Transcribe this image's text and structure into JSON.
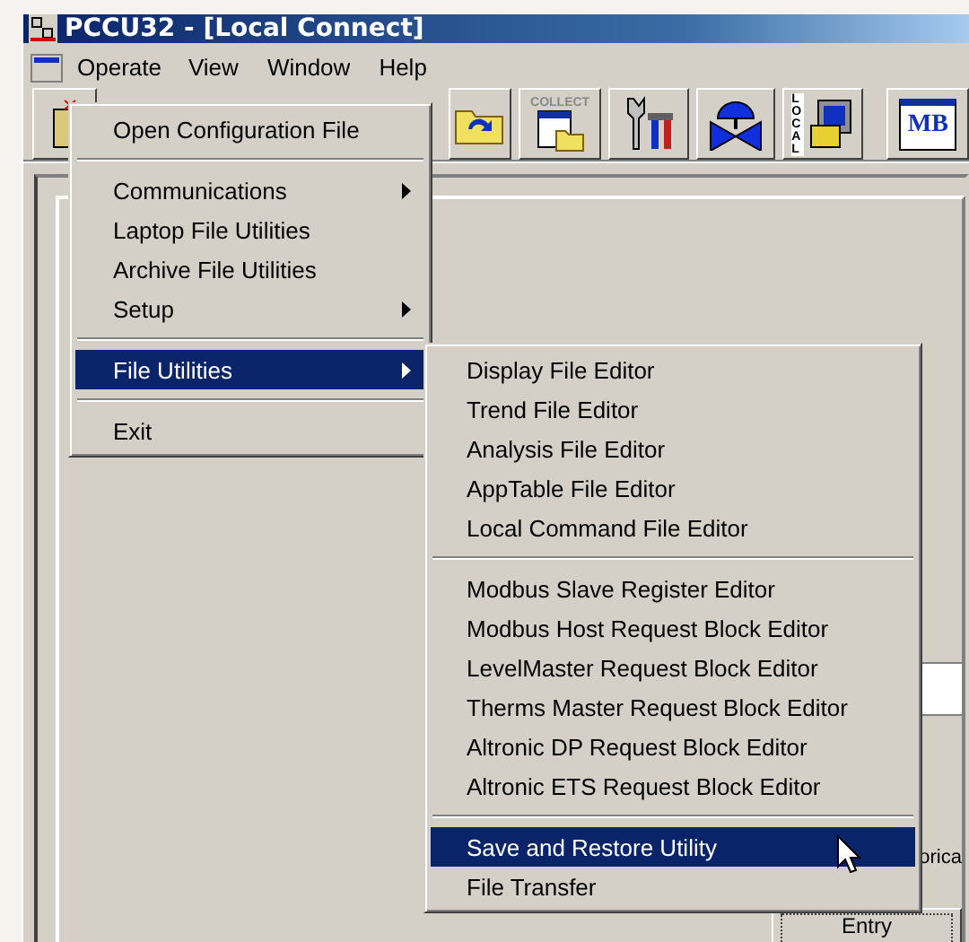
{
  "window": {
    "title": "PCCU32 - [Local Connect]"
  },
  "menu_bar": [
    {
      "label": "Operate",
      "selected": true
    },
    {
      "label": "View",
      "selected": false
    },
    {
      "label": "Window",
      "selected": false
    },
    {
      "label": "Help",
      "selected": false
    }
  ],
  "toolbar": [
    {
      "kind": "connect"
    },
    {
      "kind": "refresh_folder"
    },
    {
      "kind": "collect",
      "label": "COLLECT"
    },
    {
      "kind": "tools"
    },
    {
      "kind": "valve"
    },
    {
      "kind": "local",
      "label": "LOCAL"
    },
    {
      "kind": "modbus",
      "label": "MB"
    }
  ],
  "operate_menu": [
    {
      "kind": "item",
      "label": "Open Configuration File",
      "submenu": false,
      "selected": false
    },
    {
      "kind": "separator"
    },
    {
      "kind": "item",
      "label": "Communications",
      "submenu": true,
      "selected": false
    },
    {
      "kind": "item",
      "label": "Laptop File Utilities",
      "submenu": false,
      "selected": false
    },
    {
      "kind": "item",
      "label": "Archive File Utilities",
      "submenu": false,
      "selected": false
    },
    {
      "kind": "item",
      "label": "Setup",
      "submenu": true,
      "selected": false
    },
    {
      "kind": "separator"
    },
    {
      "kind": "item",
      "label": "File Utilities",
      "submenu": true,
      "selected": true
    },
    {
      "kind": "separator"
    },
    {
      "kind": "item",
      "label": "Exit",
      "submenu": false,
      "selected": false
    }
  ],
  "file_utilities_menu": [
    {
      "kind": "item",
      "label": "Display File Editor",
      "submenu": false,
      "selected": false
    },
    {
      "kind": "item",
      "label": "Trend File Editor",
      "submenu": false,
      "selected": false
    },
    {
      "kind": "item",
      "label": "Analysis File Editor",
      "submenu": false,
      "selected": false
    },
    {
      "kind": "item",
      "label": "AppTable File Editor",
      "submenu": false,
      "selected": false
    },
    {
      "kind": "item",
      "label": "Local Command File Editor",
      "submenu": false,
      "selected": false
    },
    {
      "kind": "separator"
    },
    {
      "kind": "item",
      "label": "Modbus Slave Register Editor",
      "submenu": false,
      "selected": false
    },
    {
      "kind": "item",
      "label": "Modbus Host Request Block Editor",
      "submenu": false,
      "selected": false
    },
    {
      "kind": "item",
      "label": "LevelMaster Request Block Editor",
      "submenu": false,
      "selected": false
    },
    {
      "kind": "item",
      "label": "Therms Master Request Block Editor",
      "submenu": false,
      "selected": false
    },
    {
      "kind": "item",
      "label": "Altronic DP Request Block Editor",
      "submenu": false,
      "selected": false
    },
    {
      "kind": "item",
      "label": "Altronic ETS Request Block Editor",
      "submenu": false,
      "selected": false
    },
    {
      "kind": "separator"
    },
    {
      "kind": "item",
      "label": "Save and Restore Utility",
      "submenu": false,
      "selected": true
    },
    {
      "kind": "item",
      "label": "File Transfer",
      "submenu": false,
      "selected": false
    }
  ],
  "background": {
    "partial_label": "orica",
    "entry_button": "Entry"
  }
}
